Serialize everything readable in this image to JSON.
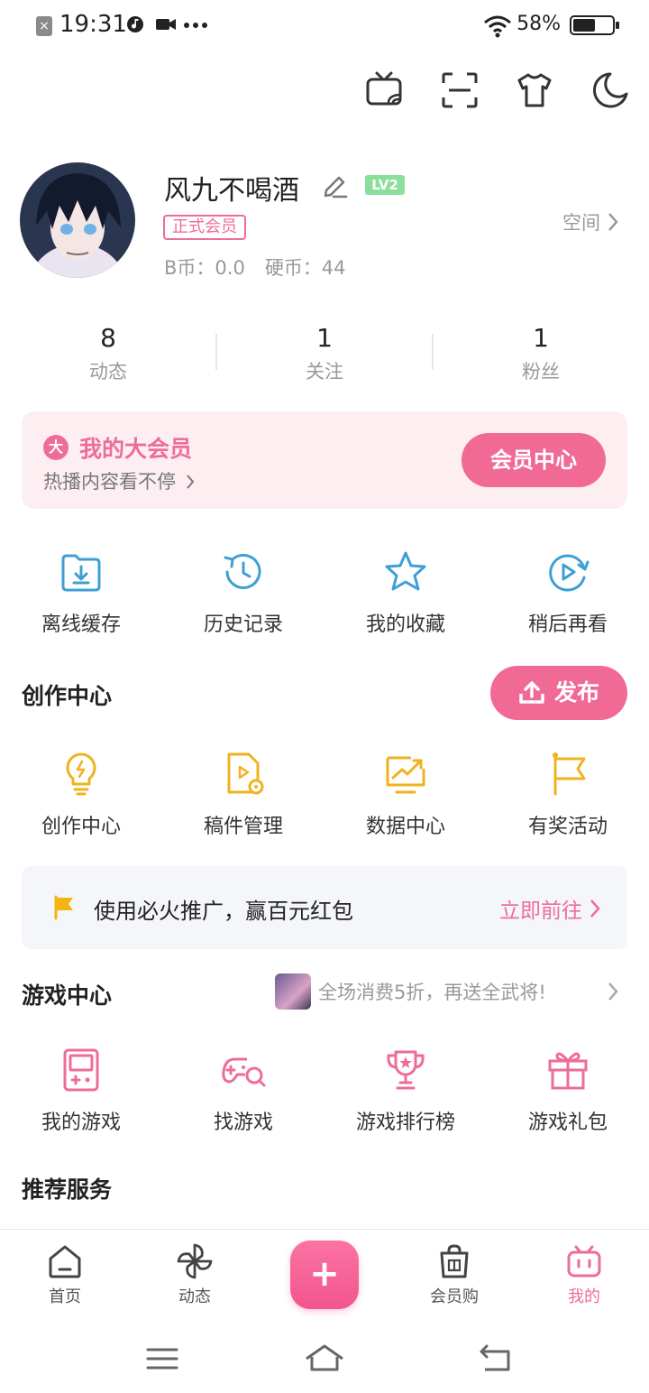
{
  "status_bar": {
    "time": "19:31",
    "battery_pct": "58%",
    "battery_level": 0.58
  },
  "profile": {
    "username": "风九不喝酒",
    "level": "LV2",
    "vip_badge": "正式会员",
    "b_coin": "B币：0.0",
    "hard_coin": "硬币：44",
    "space_link": "空间"
  },
  "stats": [
    {
      "num": "8",
      "label": "动态"
    },
    {
      "num": "1",
      "label": "关注"
    },
    {
      "num": "1",
      "label": "粉丝"
    }
  ],
  "vip_card": {
    "icon_char": "大",
    "title": "我的大会员",
    "subtitle": "热播内容看不停",
    "button": "会员中心"
  },
  "quick_actions": [
    {
      "label": "离线缓存",
      "icon": "offline-cache-icon"
    },
    {
      "label": "历史记录",
      "icon": "history-icon"
    },
    {
      "label": "我的收藏",
      "icon": "star-icon"
    },
    {
      "label": "稍后再看",
      "icon": "watch-later-icon"
    }
  ],
  "creation": {
    "title": "创作中心",
    "publish_label": "发布",
    "items": [
      {
        "label": "创作中心",
        "icon": "lightbulb-icon"
      },
      {
        "label": "稿件管理",
        "icon": "manuscript-icon"
      },
      {
        "label": "数据中心",
        "icon": "data-chart-icon"
      },
      {
        "label": "有奖活动",
        "icon": "flag-icon"
      }
    ]
  },
  "promo": {
    "text": "使用必火推广，赢百元红包",
    "action": "立即前往"
  },
  "game_center": {
    "title": "游戏中心",
    "promo_text": "全场消费5折，再送全武将!",
    "items": [
      {
        "label": "我的游戏",
        "icon": "gameboy-icon"
      },
      {
        "label": "找游戏",
        "icon": "gamepad-search-icon"
      },
      {
        "label": "游戏排行榜",
        "icon": "trophy-icon"
      },
      {
        "label": "游戏礼包",
        "icon": "gift-icon"
      }
    ]
  },
  "recommend": {
    "title": "推荐服务"
  },
  "bottom_nav": [
    {
      "label": "首页",
      "icon": "home-icon"
    },
    {
      "label": "动态",
      "icon": "pinwheel-icon"
    },
    {
      "label": "会员购",
      "icon": "shopping-bag-icon"
    },
    {
      "label": "我的",
      "icon": "tv-mascot-icon"
    }
  ],
  "colors": {
    "accent": "#f16a96",
    "pink_text": "#ee6d98",
    "blue_icon": "#3e9fd6",
    "yellow_icon": "#f0b21e"
  }
}
